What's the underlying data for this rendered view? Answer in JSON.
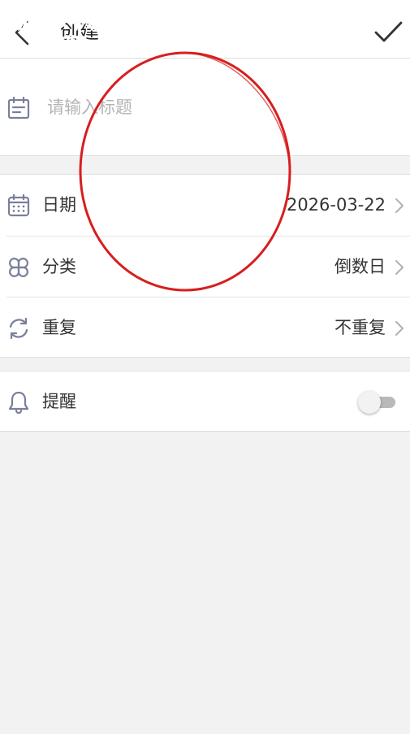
{
  "header": {
    "title": "创建",
    "back_icon": "chevron-left-icon",
    "confirm_icon": "checkmark-icon"
  },
  "watermark": {
    "line1": "游吧乐下载",
    "line2": "小编亲测",
    "color": "#2fd0e8"
  },
  "title_field": {
    "icon": "notepad-icon",
    "placeholder": "请输入标题",
    "value": ""
  },
  "settings": {
    "date": {
      "icon": "calendar-icon",
      "label": "日期",
      "value": "2026-03-22"
    },
    "category": {
      "icon": "grid-icon",
      "label": "分类",
      "value": "倒数日"
    },
    "repeat": {
      "icon": "refresh-icon",
      "label": "重复",
      "value": "不重复"
    }
  },
  "reminder": {
    "icon": "bell-icon",
    "label": "提醒",
    "enabled": false
  },
  "colors": {
    "icon": "#7a7f9a",
    "background": "#f2f2f2",
    "annotation": "#d81e1e"
  }
}
